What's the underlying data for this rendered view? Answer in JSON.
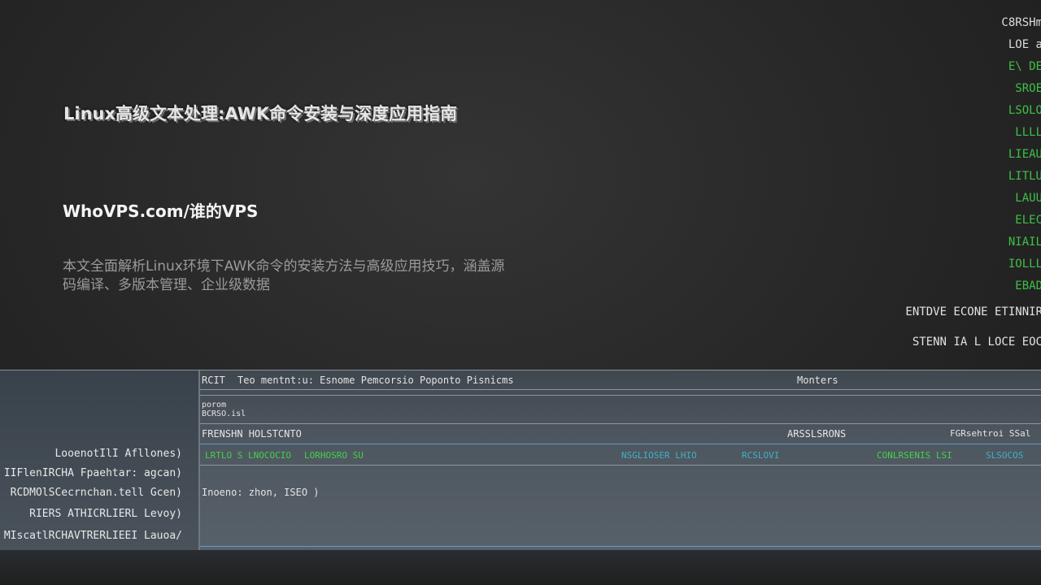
{
  "article": {
    "title": "Linux高级文本处理:AWK命令安装与深度应用指南",
    "site": "WhoVPS.com/谁的VPS",
    "description": "本文全面解析Linux环境下AWK命令的安装方法与高级应用技巧，涵盖源码编译、多版本管理、企业级数据"
  },
  "side_panel": {
    "items": [
      {
        "text": "C8RSHm",
        "tone": "white"
      },
      {
        "text": "LOE a",
        "tone": "white"
      },
      {
        "text": "E\\ DE",
        "tone": "green"
      },
      {
        "text": "SROE",
        "tone": "green"
      },
      {
        "text": "LSOLO",
        "tone": "green"
      },
      {
        "text": "LLLL",
        "tone": "green"
      },
      {
        "text": "LIEAU",
        "tone": "green"
      },
      {
        "text": "LITLU",
        "tone": "green"
      },
      {
        "text": "LAUU",
        "tone": "green"
      },
      {
        "text": "ELEC",
        "tone": "green"
      },
      {
        "text": "NIAIL",
        "tone": "green"
      },
      {
        "text": "IOLLL",
        "tone": "green"
      },
      {
        "text": "EBAD",
        "tone": "green"
      }
    ],
    "footer1": "ENTDVE ECONE ETINNIR",
    "footer2": "STENN IA L LOCE EOC"
  },
  "terminal": {
    "header_left": "RCIT",
    "header_text": "Teo mentnt:u: Esnome Pemcorsio Poponto Pisnicms",
    "header_right": "Monters",
    "sub1": "porom",
    "sub2": "BCRSO.isl",
    "section_left": "FRENSHN HOLSTCNTO",
    "section_mid": "ARSSLSRONS",
    "section_right": "FGRsehtroi SSal",
    "data_green1": "LRTLO S LNOCOCIO",
    "data_green2": "LORHOSRO SU",
    "data_cyan1": "NSGLIOSER LHIO",
    "data_cyan2": "RCSLOVI",
    "data_green3": "CONLRSENIS LSI",
    "data_cyan3": "SLSOCOS",
    "output_line": "Inoeno: zhon, ISEO )",
    "left_rows": [
      "LooenotIlI Afllones)",
      "IIFlenIRCHA Fpaehtar: agcan)",
      "RCDMOlSCecrnchan.tell Gcen)",
      "RIERS ATHICRLIERL Levoy)",
      "MIscatlRCHAVTRERLIEEI Lauoa/"
    ]
  }
}
